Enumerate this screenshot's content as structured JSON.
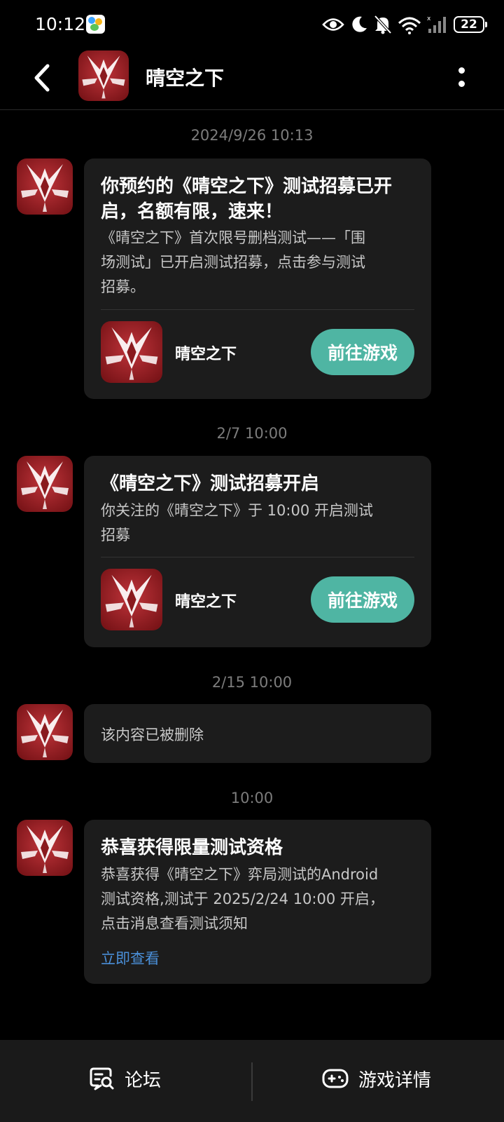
{
  "status_bar": {
    "time": "10:12",
    "battery": "22",
    "icons": [
      "eye-icon",
      "moon-icon",
      "bell-off-icon",
      "wifi-icon",
      "signal-icon",
      "battery-icon"
    ]
  },
  "header": {
    "title": "晴空之下",
    "back_icon": "back-arrow-icon",
    "more_icon": "more-vertical-icon"
  },
  "messages": [
    {
      "time": "2024/9/26  10:13",
      "title_lines": [
        "你预约的《晴空之下》测试招募已开",
        "启，名额有限，速来！"
      ],
      "body_lines": [
        "《晴空之下》首次限号删档测试——「围",
        "场测试」已开启测试招募，点击参与测试",
        "招募。"
      ],
      "game_name": "晴空之下",
      "button": "前往游戏"
    },
    {
      "time": "2/7  10:00",
      "title_lines": [
        "《晴空之下》测试招募开启"
      ],
      "body_lines": [
        "你关注的《晴空之下》于 10:00 开启测试",
        "招募"
      ],
      "game_name": "晴空之下",
      "button": "前往游戏"
    },
    {
      "time": "2/15  10:00",
      "body": "该内容已被删除"
    },
    {
      "time": "10:00",
      "title_lines": [
        "恭喜获得限量测试资格"
      ],
      "body_lines": [
        "恭喜获得《晴空之下》弈局测试的Android",
        "测试资格,测试于 2025/2/24 10:00 开启，",
        "点击消息查看测试须知"
      ],
      "link": "立即查看"
    }
  ],
  "bottom_bar": {
    "forum": "论坛",
    "game_detail": "游戏详情",
    "forum_icon": "forum-search-icon",
    "game_icon": "gamepad-icon"
  },
  "colors": {
    "background": "#000000",
    "card": "#1c1c1c",
    "button": "#4fb5a3",
    "link": "#4a8fd8"
  }
}
